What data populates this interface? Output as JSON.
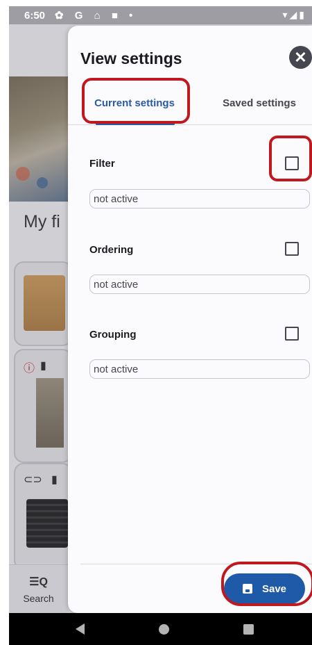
{
  "status_bar": {
    "time": "6:50",
    "icons": "✿ G ⌂ ■ •",
    "right_icons": "▾◢▮"
  },
  "background_app": {
    "title": "My fi",
    "bottom_nav": {
      "icon": "☰Q",
      "label": "Search"
    }
  },
  "dialog": {
    "title": "View settings",
    "close_icon": "✕",
    "tabs": [
      {
        "label": "Current settings",
        "active": true
      },
      {
        "label": "Saved settings",
        "active": false
      }
    ],
    "sections": [
      {
        "label": "Filter",
        "checked": false,
        "value": "not active"
      },
      {
        "label": "Ordering",
        "checked": false,
        "value": "not active"
      },
      {
        "label": "Grouping",
        "checked": false,
        "value": "not active"
      }
    ],
    "save_label": "Save"
  },
  "colors": {
    "accent": "#2a5aa6",
    "save_button": "#1f5aa8",
    "annotation": "#c0181f"
  }
}
